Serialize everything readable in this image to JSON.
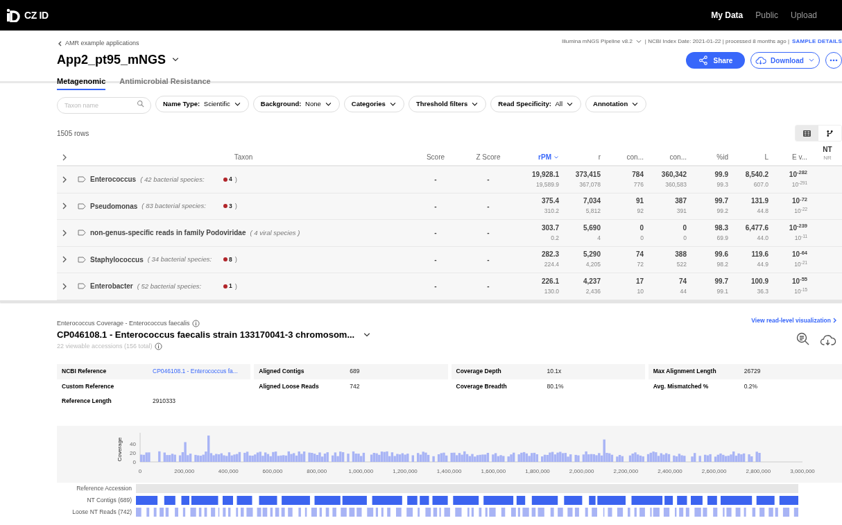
{
  "top_nav": {
    "logo": "CZ ID",
    "links": [
      {
        "label": "My Data",
        "selected": true
      },
      {
        "label": "Public",
        "selected": false
      },
      {
        "label": "Upload",
        "selected": false
      }
    ]
  },
  "breadcrumb": "AMR example applications",
  "sample_name": "App2_pt95_mNGS",
  "pipeline_info": {
    "pipeline": "Illumina mNGS Pipeline v8.2",
    "meta": "| NCBI Index Date: 2021-01-22 | processed 8 months ago |",
    "details_link": "SAMPLE DETAILS"
  },
  "actions": {
    "share": "Share",
    "download": "Download"
  },
  "tabs": [
    {
      "label": "Metagenomic",
      "selected": true
    },
    {
      "label": "Antimicrobial Resistance",
      "selected": false
    }
  ],
  "filters": {
    "search_placeholder": "Taxon name",
    "dropdowns": [
      {
        "label": "Name Type:",
        "value": "Scientific"
      },
      {
        "label": "Background:",
        "value": "None"
      },
      {
        "label": "Categories"
      },
      {
        "label": "Threshold filters"
      },
      {
        "label": "Read Specificity:",
        "value": "All"
      },
      {
        "label": "Annotation"
      }
    ]
  },
  "row_count": "1505 rows",
  "view_toggle": [
    {
      "kind": "table",
      "selected": true
    },
    {
      "kind": "tree",
      "selected": false
    }
  ],
  "table": {
    "columns": [
      {
        "label": "Taxon",
        "sorted": false
      },
      {
        "label": "Score",
        "sorted": false
      },
      {
        "label": "Z Score",
        "sorted": false
      },
      {
        "label": "rPM",
        "sorted": true
      },
      {
        "label": "r",
        "sorted": false
      },
      {
        "label": "con...",
        "sorted": false
      },
      {
        "label": "con...",
        "sorted": false
      },
      {
        "label": "%id",
        "sorted": false
      },
      {
        "label": "L",
        "sorted": false
      },
      {
        "label": "E v...",
        "sorted": false
      }
    ],
    "db_toggle": {
      "top": "NT",
      "bottom": "NR"
    },
    "rows": [
      {
        "name": "Enterococcus",
        "detail": "( 42 bacterial species:",
        "flag": {
          "count": "4",
          "color": "#b1252a"
        },
        "detail_end": ")",
        "score": "-",
        "z_score": "-",
        "values": [
          [
            "19,928.1",
            "19,589.9"
          ],
          [
            "373,415",
            "367,078"
          ],
          [
            "784",
            "776"
          ],
          [
            "360,342",
            "360,583"
          ],
          [
            "99.9",
            "99.3"
          ],
          [
            "8,540.2",
            "607.0"
          ],
          [
            "10$^{-282}$",
            "10$^{-291}$"
          ]
        ]
      },
      {
        "name": "Pseudomonas",
        "detail": "( 83 bacterial species:",
        "flag": {
          "count": "3",
          "color": "#b1252a"
        },
        "detail_end": ")",
        "score": "-",
        "z_score": "-",
        "values": [
          [
            "375.4",
            "310.2"
          ],
          [
            "7,034",
            "5,812"
          ],
          [
            "91",
            "92"
          ],
          [
            "387",
            "391"
          ],
          [
            "99.7",
            "99.2"
          ],
          [
            "131.9",
            "44.8"
          ],
          [
            "10$^{-72}$",
            "10$^{-22}$"
          ]
        ]
      },
      {
        "name": "non-genus-specific reads in family Podoviridae",
        "detail": "( 4 viral species )",
        "score": "-",
        "z_score": "-",
        "values": [
          [
            "303.7",
            "0.2"
          ],
          [
            "5,690",
            "4"
          ],
          [
            "0",
            "0"
          ],
          [
            "0",
            "0"
          ],
          [
            "98.3",
            "69.9"
          ],
          [
            "6,477.6",
            "44.0"
          ],
          [
            "10$^{-239}$",
            "10$^{-11}$"
          ]
        ]
      },
      {
        "name": "Staphylococcus",
        "detail": "( 34 bacterial species:",
        "flag": {
          "count": "8",
          "color": "#b1252a"
        },
        "detail_end": ")",
        "score": "-",
        "z_score": "-",
        "values": [
          [
            "282.3",
            "224.4"
          ],
          [
            "5,290",
            "4,205"
          ],
          [
            "74",
            "72"
          ],
          [
            "388",
            "522"
          ],
          [
            "99.6",
            "98.2"
          ],
          [
            "119.6",
            "44.9"
          ],
          [
            "10$^{-64}$",
            "10$^{-21}$"
          ]
        ]
      },
      {
        "name": "Enterobacter",
        "detail": "( 52 bacterial species:",
        "flag": {
          "count": "1",
          "color": "#b1252a"
        },
        "detail_end": ")",
        "score": "-",
        "z_score": "-",
        "values": [
          [
            "226.1",
            "130.0"
          ],
          [
            "4,237",
            "2,436"
          ],
          [
            "17",
            "10"
          ],
          [
            "74",
            "44"
          ],
          [
            "99.7",
            "99.1"
          ],
          [
            "100.9",
            "36.3"
          ],
          [
            "10$^{-55}$",
            "10$^{-15}$"
          ]
        ]
      }
    ]
  },
  "coverage": {
    "title": "Enterococcus Coverage - Enterococcus faecalis",
    "accession": "CP046108.1 - Enterococcus faecalis strain 133170041-3 chromosom...",
    "accessions_note": "22 viewable accessions (156 total)",
    "read_link": "View read-level visualization",
    "metrics": [
      [
        {
          "label": "NCBI Reference",
          "value": "CP046108.1 - Enterococcus fa...",
          "kind": "link"
        },
        {
          "label": "Custom Reference",
          "kind": "text"
        },
        {
          "label": "Reference Length",
          "value": "2910333",
          "kind": "text"
        }
      ],
      [
        {
          "label": "Aligned Contigs",
          "value": "689",
          "kind": "text"
        },
        {
          "label": "Aligned Loose Reads",
          "value": "742",
          "kind": "text"
        }
      ],
      [
        {
          "label": "Coverage Depth",
          "value": "10.1x",
          "kind": "text"
        },
        {
          "label": "Coverage Breadth",
          "value": "80.1%",
          "kind": "text"
        }
      ],
      [
        {
          "label": "Max Alignment Length",
          "value": "26729",
          "kind": "text"
        },
        {
          "label": "Avg. Mismatched %",
          "value": "0.2%",
          "kind": "text"
        }
      ]
    ],
    "plot": {
      "ylabel": "Coverage",
      "yticks": [
        "40",
        "20",
        "0"
      ],
      "xticks": [
        "0",
        "200,000",
        "400,000",
        "600,000",
        "800,000",
        "1,000,000",
        "1,200,000",
        "1,400,000",
        "1,600,000",
        "1,800,000",
        "2,000,000",
        "2,200,000",
        "2,400,000",
        "2,600,000",
        "2,800,000",
        "3,000,000"
      ]
    },
    "tracks": [
      {
        "kind": "reference",
        "label": "Reference Accession"
      },
      {
        "kind": "contigs",
        "label": "NT Contigs (689)"
      },
      {
        "kind": "reads",
        "label": "Loose NT Reads (742)"
      }
    ]
  }
}
